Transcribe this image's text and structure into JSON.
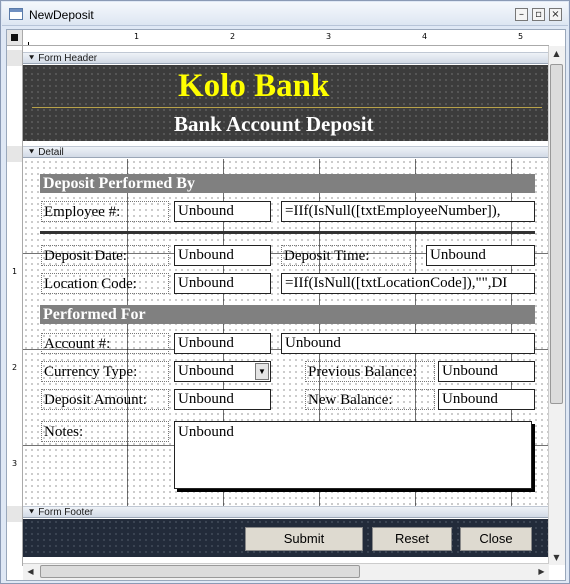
{
  "window": {
    "title": "NewDeposit"
  },
  "ruler": {
    "h": [
      "1",
      "2",
      "3",
      "4",
      "5"
    ],
    "v": [
      "1",
      "2",
      "3"
    ]
  },
  "sections": {
    "header": "Form Header",
    "detail": "Detail",
    "footer": "Form Footer"
  },
  "header": {
    "bank_name": "Kolo Bank",
    "subtitle": "Bank Account Deposit"
  },
  "groups": {
    "performed_by": "Deposit Performed By",
    "performed_for": "Performed For"
  },
  "fields": {
    "employee_label": "Employee #:",
    "employee_value": "Unbound",
    "employee_expr": "=IIf(IsNull([txtEmployeeNumber]),",
    "date_label": "Deposit Date:",
    "date_value": "Unbound",
    "time_label": "Deposit Time:",
    "time_value": "Unbound",
    "location_label": "Location Code:",
    "location_value": "Unbound",
    "location_expr": "=IIf(IsNull([txtLocationCode]),\"\",DI",
    "account_label": "Account #:",
    "account_value": "Unbound",
    "account_name": "Unbound",
    "currency_label": "Currency Type:",
    "currency_value": "Unbound",
    "prev_balance_label": "Previous Balance:",
    "prev_balance_value": "Unbound",
    "amount_label": "Deposit Amount:",
    "amount_value": "Unbound",
    "new_balance_label": "New Balance:",
    "new_balance_value": "Unbound",
    "notes_label": "Notes:",
    "notes_value": "Unbound"
  },
  "buttons": {
    "submit": "Submit",
    "reset": "Reset",
    "close": "Close"
  },
  "icons": {
    "form": "form-icon",
    "minimize": "minimize-icon",
    "restore": "restore-icon",
    "close": "close-icon",
    "combo": "dropdown-arrow-icon"
  }
}
